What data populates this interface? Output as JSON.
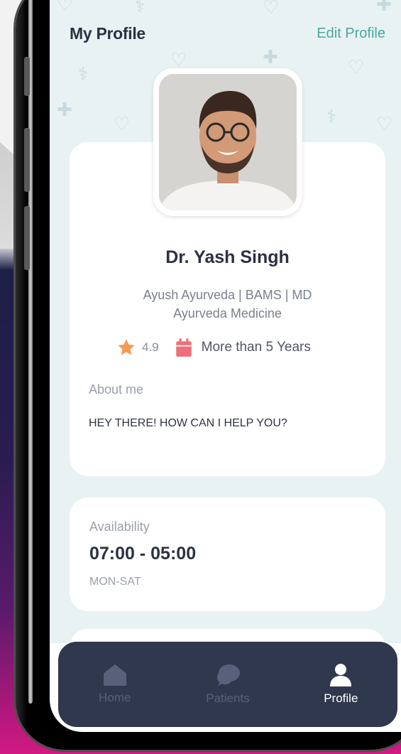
{
  "header": {
    "title": "My Profile",
    "edit_label": "Edit Profile"
  },
  "profile": {
    "name": "Dr. Yash Singh",
    "qualification_line1": "Ayush Ayurveda | BAMS | MD",
    "qualification_line2": "Ayurveda Medicine",
    "rating": "4.9",
    "experience": "More than 5 Years",
    "about_label": "About me",
    "about_text": "HEY THERE! HOW CAN I HELP YOU?"
  },
  "availability": {
    "label": "Availability",
    "hours": "07:00 - 05:00",
    "days": "MON-SAT"
  },
  "nav": {
    "items": [
      {
        "label": "Home",
        "icon": "home-icon",
        "active": false
      },
      {
        "label": "Patients",
        "icon": "chat-icon",
        "active": false
      },
      {
        "label": "Profile",
        "icon": "user-icon",
        "active": true
      }
    ]
  },
  "colors": {
    "accent": "#4ca6a0",
    "star": "#f49a55",
    "calendar": "#ef6e79",
    "nav_bg": "#2f384d",
    "title": "#2b3143"
  }
}
